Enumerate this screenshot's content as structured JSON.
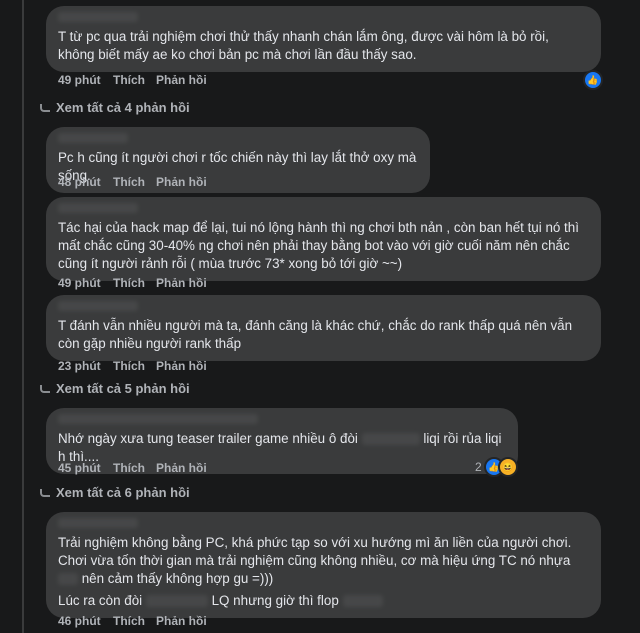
{
  "comments": [
    {
      "text": "T từ pc qua trải nghiệm chơi thử thấy nhanh chán lắm ông, được vài hôm là bỏ rồi, không biết mấy ae ko chơi bản pc mà chơi lần đầu thấy sao.",
      "time": "49 phút",
      "like": "Thích",
      "reply": "Phản hồi",
      "reaction_count": ""
    },
    {
      "text": "Pc h cũng ít người chơi r tốc chiến này thì lay lắt thở oxy mà sống.",
      "time": "48 phút",
      "like": "Thích",
      "reply": "Phản hồi"
    },
    {
      "text": "Tác hại của hack map để lại, tui nó lộng hành thì ng chơi bth nản , còn ban hết tụi nó thì mất chắc cũng 30-40% ng chơi nên phải thay bằng bot vào với giờ cuối năm nên chắc cũng ít người rảnh rỗi ( mùa trước 73* xong bỏ tới giờ ~~)",
      "time": "49 phút",
      "like": "Thích",
      "reply": "Phản hồi"
    },
    {
      "text": "T đánh vẫn nhiều người mà ta, đánh căng là khác chứ, chắc do rank thấp quá nên vẫn còn gặp nhiều người rank thấp",
      "time": "23 phút",
      "like": "Thích",
      "reply": "Phản hồi"
    },
    {
      "text_a": "Nhớ ngày xưa tung teaser trailer game nhiều ô đòi",
      "text_b": "liqi rồi rủa liqi h thì....",
      "time": "45 phút",
      "like": "Thích",
      "reply": "Phản hồi",
      "reaction_count": "2"
    },
    {
      "text": "Trải nghiệm không bằng PC, khá phức tạp so với xu hướng mì ăn liền của người chơi. Chơi vừa tốn thời gian mà trải nghiệm cũng không nhiều, cơ mà hiệu ứng TC nó nhựa",
      "text_tail": "nên cảm thấy không hợp gu =)))",
      "line2_a": "Lúc ra còn đòi",
      "line2_b": "LQ nhưng giờ thì flop",
      "time": "46 phút",
      "like": "Thích",
      "reply": "Phản hồi"
    }
  ],
  "view_more": [
    "Xem tất cả 4 phản hồi",
    "Xem tất cả 5 phản hồi",
    "Xem tất cả 6 phản hồi"
  ],
  "icons": {
    "like": "like-icon",
    "haha": "haha-icon",
    "reply_arrow": "reply-arrow-icon"
  },
  "colors": {
    "background": "#18191a",
    "bubble": "#3a3b3c",
    "meta": "#b0b3b8",
    "like_blue": "#1877f2"
  }
}
